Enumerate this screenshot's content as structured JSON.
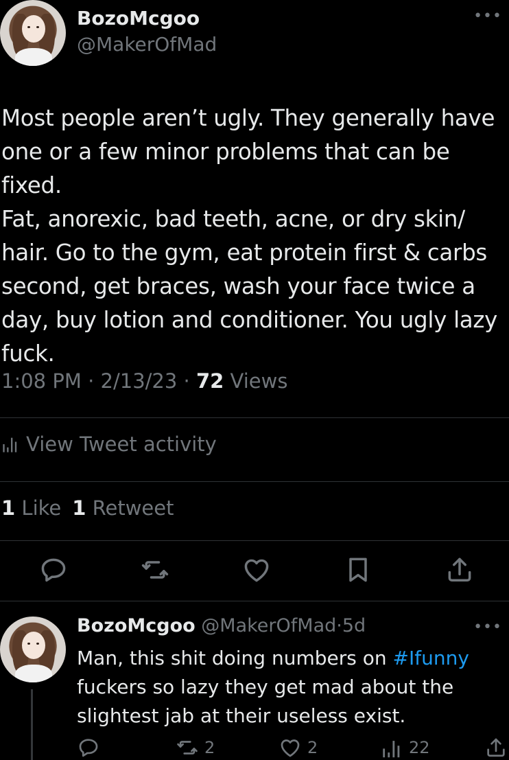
{
  "tweet": {
    "author_name": "BozoMcgoo",
    "author_handle": "@MakerOfMad",
    "more_icon": "more-horizontal-icon",
    "text": "Most people aren’t ugly. They generally have\none or a few minor problems that can be fixed.\nFat, anorexic, bad teeth, acne, or dry skin/\nhair. Go to the gym, eat protein first & carbs\nsecond, get braces, wash your face twice a\nday, buy lotion and conditioner. You ugly lazy\nfuck.",
    "time": "1:08 PM",
    "date": "2/13/23",
    "separator": "·",
    "views_count": "72",
    "views_label": "Views",
    "activity_label": "View Tweet activity",
    "likes_count": "1",
    "likes_label": "Like",
    "retweets_count": "1",
    "retweets_label": "Retweet"
  },
  "actions": [
    {
      "icon": "reply-icon"
    },
    {
      "icon": "retweet-icon"
    },
    {
      "icon": "like-icon"
    },
    {
      "icon": "bookmark-icon"
    },
    {
      "icon": "share-icon"
    }
  ],
  "reply": {
    "author_name": "BozoMcgoo",
    "author_handle": "@MakerOfMad",
    "separator": "·",
    "age": "5d",
    "text_before": "Man, this shit doing numbers on ",
    "hashtag": "#Ifunny",
    "text_after": "\nfuckers so lazy they get mad about the\nslightest jab at their useless exist.",
    "retweets": "2",
    "likes": "2",
    "views": "22"
  },
  "colors": {
    "background": "#000000",
    "text": "#e7e9ea",
    "muted": "#71767b",
    "link": "#1d9bf0",
    "divider": "#2f3336"
  }
}
